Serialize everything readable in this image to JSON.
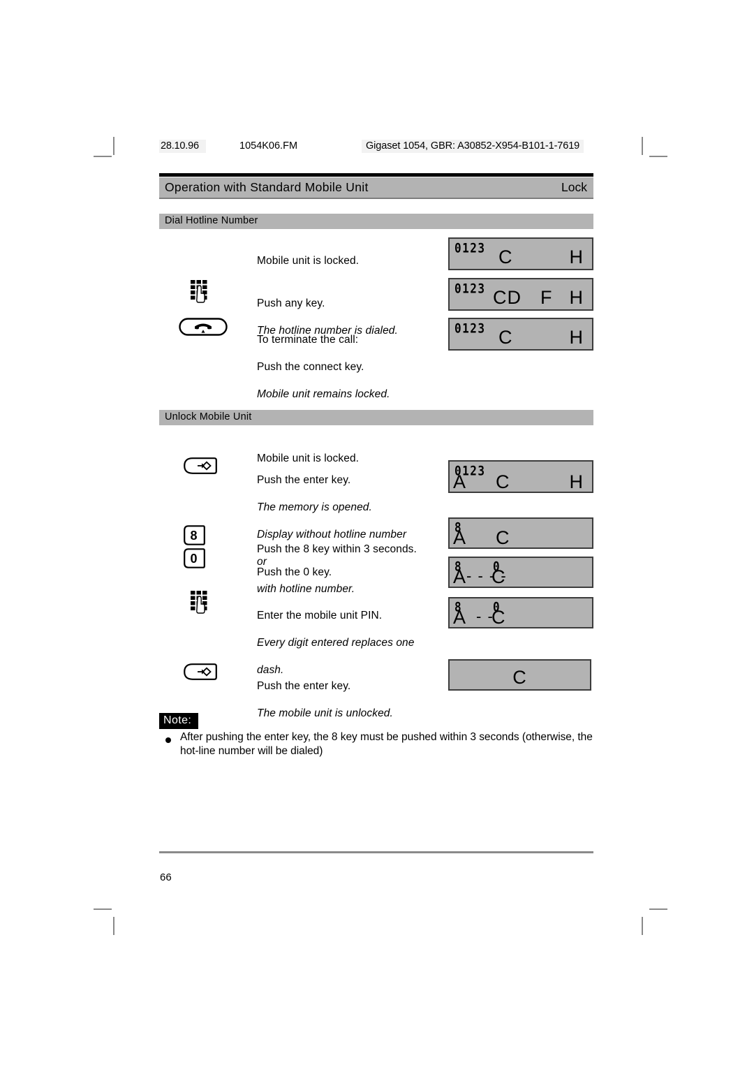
{
  "runhead": {
    "date": "28.10.96",
    "filename": "1054K06.FM",
    "docid": "Gigaset 1054, GBR: A30852-X954-B101-1-7619"
  },
  "title": {
    "left": "Operation with Standard Mobile Unit",
    "right": "Lock"
  },
  "sections": [
    {
      "heading": "Dial Hotline Number",
      "steps": [
        {
          "icon": "none",
          "lines": [
            "Mobile unit is locked."
          ],
          "display": {
            "segments": "0123",
            "symbols": "C    H"
          }
        },
        {
          "icon": "keypad-icon",
          "lines": [
            "Push any key.",
            "The hotline number is dialed."
          ],
          "display": {
            "segments": "0123",
            "symbols": "CD  F   H"
          }
        },
        {
          "icon": "connect-key-icon",
          "lines": [
            "To terminate the call:",
            "Push the connect key.",
            "Mobile unit remains locked."
          ],
          "display": {
            "segments": "0123",
            "symbols": "C    H"
          }
        }
      ]
    },
    {
      "heading": "Unlock Mobile Unit",
      "steps": [
        {
          "icon": "none",
          "lines": [
            "Mobile unit is locked."
          ],
          "display": null
        },
        {
          "icon": "enter-key-icon",
          "lines": [
            "Push the enter key.",
            "The memory is opened.",
            "Display without hotline number",
            "or",
            "with hotline number."
          ],
          "display": {
            "segments": "0123",
            "symbols": "A   C    H"
          }
        },
        {
          "icon": "number-key-8",
          "lines": [
            "Push the 8 key within 3 seconds."
          ],
          "display": {
            "segments": "8",
            "symbols": "A   C"
          }
        },
        {
          "icon": "number-key-0",
          "lines": [
            "Push the 0 key."
          ],
          "display": {
            "segments": "8 0",
            "symbols": "A - - - - C"
          }
        },
        {
          "icon": "keypad-icon",
          "lines": [
            "Enter the mobile unit PIN.",
            "Every digit entered replaces one dash."
          ],
          "display": {
            "segments": "8 0",
            "symbols": "A - - C"
          }
        },
        {
          "icon": "enter-key-icon",
          "lines": [
            "Push the enter key.",
            "The mobile unit is unlocked."
          ],
          "display": {
            "segments": "",
            "symbols": "C"
          }
        }
      ]
    }
  ],
  "lcd": {
    "d1": {
      "seg": "0123",
      "c": "C",
      "h": "H"
    },
    "d2": {
      "seg": "0123",
      "cd": "CD",
      "f": "F",
      "h": "H"
    },
    "d3": {
      "seg": "0123",
      "c": "C",
      "h": "H"
    },
    "d4": {
      "seg": "0123",
      "a": "A",
      "c": "C",
      "h": "H"
    },
    "d5": {
      "seg8": "8",
      "a": "A",
      "c": "C"
    },
    "d6": {
      "seg8": "8",
      "seg0": "0",
      "a": "A",
      "c": "C",
      "dashes": "- - - -"
    },
    "d7": {
      "seg8": "8",
      "seg0": "0",
      "a": "A",
      "c": "C",
      "dashes": "- -"
    },
    "d8": {
      "c": "C"
    }
  },
  "steptext": {
    "s1_l1": "Mobile unit is locked.",
    "s2_l1": "Push any key.",
    "s2_l2": "The hotline number is dialed.",
    "s3_l1": "To terminate the call:",
    "s3_l2": "Push the connect key.",
    "s3_l3": "Mobile unit remains locked.",
    "s4_l1": "Mobile unit is locked.",
    "s5_l1": "Push the enter key.",
    "s5_l2": "The memory is opened.",
    "s5_l3": "Display without hotline number",
    "s5_l4": "or",
    "s5_l5": "with hotline number.",
    "s6_l1": "Push the 8 key within 3 seconds.",
    "s7_l1": "Push the 0 key.",
    "s8_l1": "Enter the mobile unit PIN.",
    "s8_l2": "Every digit entered replaces one",
    "s8_l3": "dash.",
    "s9_l1": "Push the enter key.",
    "s9_l2": "The mobile unit is unlocked."
  },
  "keys": {
    "key8": "8",
    "key0": "0"
  },
  "note": {
    "label": "Note:",
    "text": "After pushing the enter key, the 8 key must be pushed within 3 seconds (otherwise, the hot-line number will be dialed)"
  },
  "footer": {
    "page": "66"
  },
  "colors": {
    "lcd_background": "#b3b3b3",
    "bar_background": "#b3b3b3",
    "note_background": "#000000",
    "rule": "#8a8a8a"
  }
}
